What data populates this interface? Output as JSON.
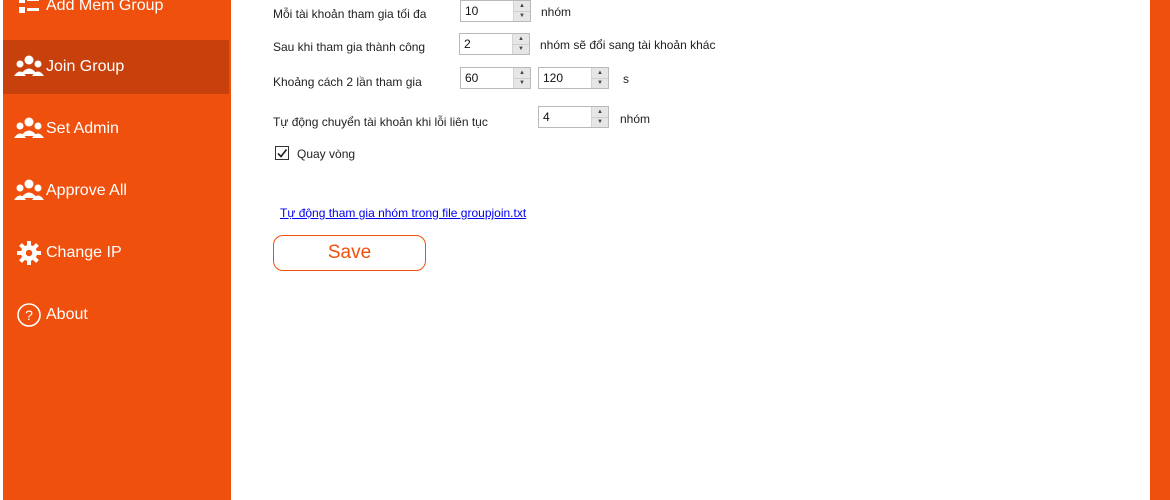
{
  "sidebar": {
    "items": [
      {
        "label": "Add Mem Group",
        "icon": "list-icon"
      },
      {
        "label": "Join Group",
        "icon": "users-icon",
        "active": true
      },
      {
        "label": "Set Admin",
        "icon": "users-icon"
      },
      {
        "label": "Approve All",
        "icon": "users-icon"
      },
      {
        "label": "Change IP",
        "icon": "gear-icon"
      },
      {
        "label": "About",
        "icon": "question-icon"
      }
    ]
  },
  "form": {
    "max_groups_label": "Mỗi tài khoản tham gia tối đa",
    "max_groups_value": "10",
    "max_groups_unit": "nhóm",
    "switch_after_label": "Sau khi tham gia thành công",
    "switch_after_value": "2",
    "switch_after_unit": "nhóm sẽ đổi sang tài khoản khác",
    "interval_label": "Khoảng cách 2 lần tham gia",
    "interval_min": "60",
    "interval_max": "120",
    "interval_unit": "s",
    "auto_switch_label": "Tự động chuyển tài khoản khi lỗi liên tục",
    "auto_switch_value": "4",
    "auto_switch_unit": "nhóm",
    "loop_label": "Quay vòng",
    "loop_checked": true,
    "file_link": "Tự động tham gia nhóm trong file groupjoin.txt",
    "save_label": "Save"
  },
  "colors": {
    "accent": "#f0500e",
    "active_item": "#c8400c"
  }
}
